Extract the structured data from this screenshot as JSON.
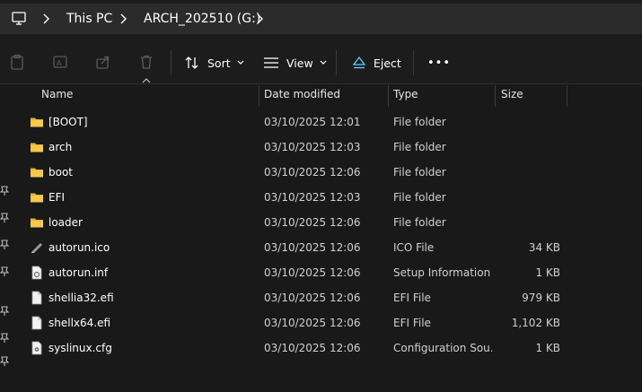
{
  "address": {
    "crumbs": [
      "This PC",
      "ARCH_202510 (G:)"
    ]
  },
  "toolbar": {
    "sort_label": "Sort",
    "view_label": "View",
    "eject_label": "Eject",
    "more_label": "•••"
  },
  "columns": {
    "name": "Name",
    "date": "Date modified",
    "type": "Type",
    "size": "Size"
  },
  "files": [
    {
      "name": "[BOOT]",
      "date": "03/10/2025 12:01",
      "type": "File folder",
      "size": "",
      "icon": "folder-icon"
    },
    {
      "name": "arch",
      "date": "03/10/2025 12:03",
      "type": "File folder",
      "size": "",
      "icon": "folder-icon"
    },
    {
      "name": "boot",
      "date": "03/10/2025 12:06",
      "type": "File folder",
      "size": "",
      "icon": "folder-icon"
    },
    {
      "name": "EFI",
      "date": "03/10/2025 12:03",
      "type": "File folder",
      "size": "",
      "icon": "folder-icon"
    },
    {
      "name": "loader",
      "date": "03/10/2025 12:06",
      "type": "File folder",
      "size": "",
      "icon": "folder-icon"
    },
    {
      "name": "autorun.ico",
      "date": "03/10/2025 12:06",
      "type": "ICO File",
      "size": "34 KB",
      "icon": "ico-file-icon"
    },
    {
      "name": "autorun.inf",
      "date": "03/10/2025 12:06",
      "type": "Setup Information",
      "size": "1 KB",
      "icon": "setup-file-icon"
    },
    {
      "name": "shellia32.efi",
      "date": "03/10/2025 12:06",
      "type": "EFI File",
      "size": "979 KB",
      "icon": "file-icon"
    },
    {
      "name": "shellx64.efi",
      "date": "03/10/2025 12:06",
      "type": "EFI File",
      "size": "1,102 KB",
      "icon": "file-icon"
    },
    {
      "name": "syslinux.cfg",
      "date": "03/10/2025 12:06",
      "type": "Configuration Sou...",
      "size": "1 KB",
      "icon": "config-file-icon"
    }
  ],
  "colors": {
    "background": "#191919",
    "address_box": "#2b2b2b",
    "folder": "#e8b33a",
    "accent": "#60cdff"
  }
}
